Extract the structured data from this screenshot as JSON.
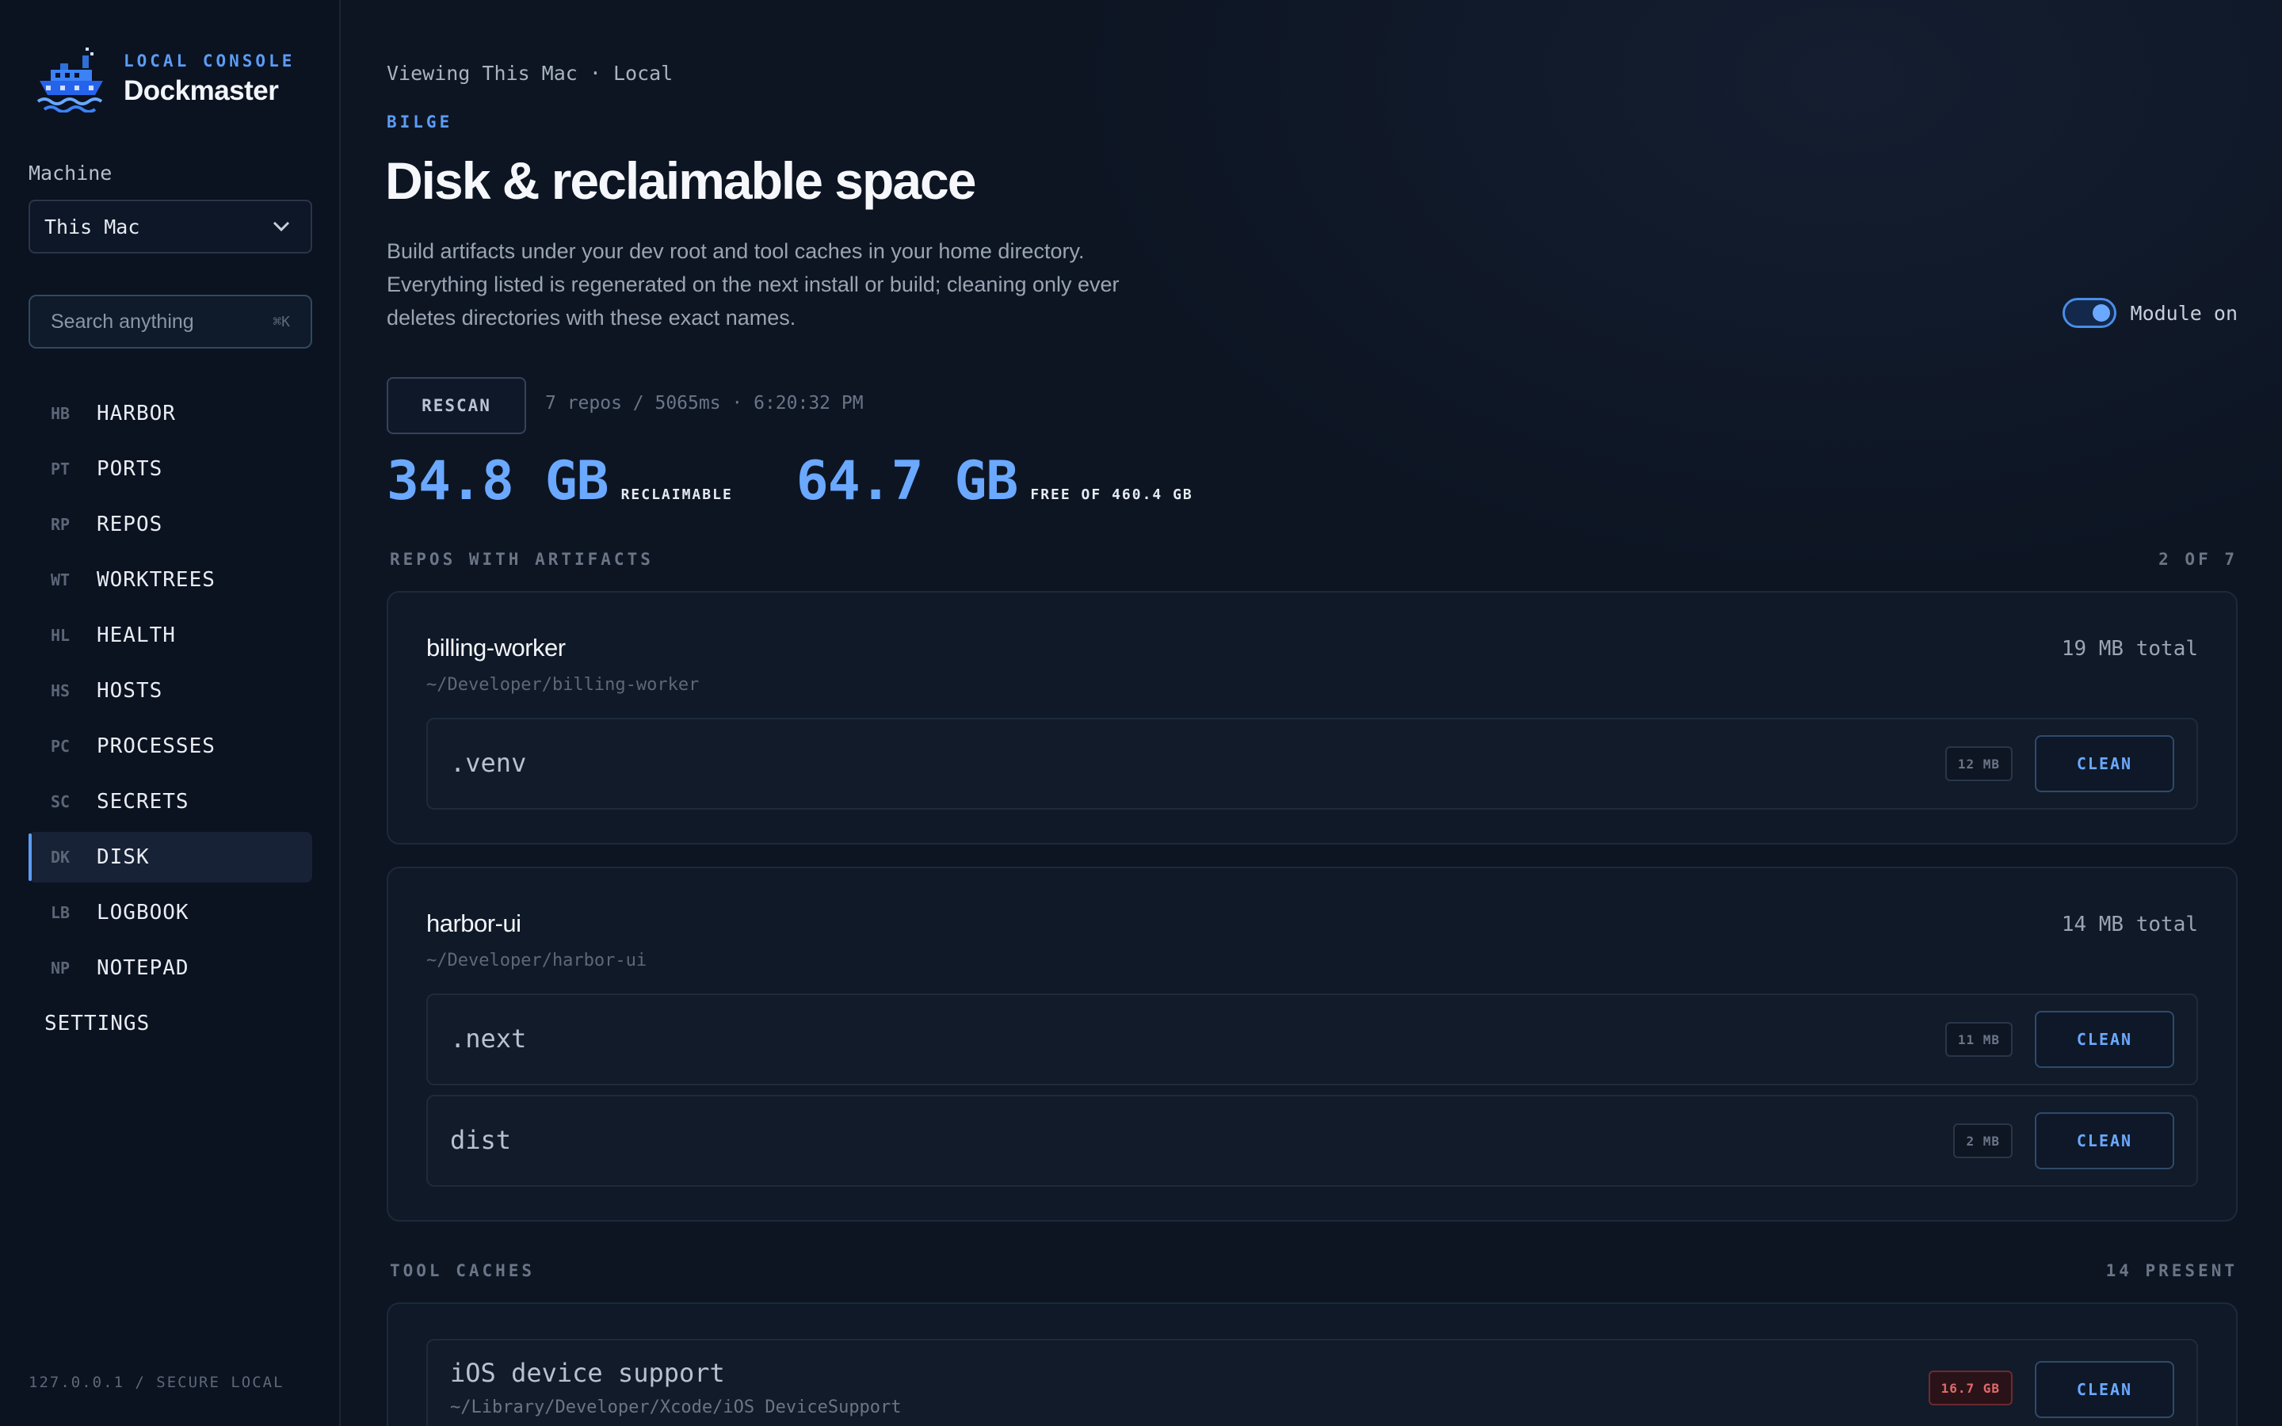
{
  "brand": {
    "eyebrow": "LOCAL CONSOLE",
    "name": "Dockmaster",
    "logo_icon": "ship-icon"
  },
  "machine": {
    "label": "Machine",
    "selected": "This Mac"
  },
  "search": {
    "placeholder": "Search anything",
    "shortcut": "⌘K"
  },
  "nav": {
    "items": [
      {
        "code": "HB",
        "label": "HARBOR"
      },
      {
        "code": "PT",
        "label": "PORTS"
      },
      {
        "code": "RP",
        "label": "REPOS"
      },
      {
        "code": "WT",
        "label": "WORKTREES"
      },
      {
        "code": "HL",
        "label": "HEALTH"
      },
      {
        "code": "HS",
        "label": "HOSTS"
      },
      {
        "code": "PC",
        "label": "PROCESSES"
      },
      {
        "code": "SC",
        "label": "SECRETS"
      },
      {
        "code": "DK",
        "label": "DISK"
      },
      {
        "code": "LB",
        "label": "LOGBOOK"
      },
      {
        "code": "NP",
        "label": "NOTEPAD"
      }
    ],
    "active": "DISK",
    "settings": "SETTINGS"
  },
  "footer": {
    "address": "127.0.0.1 / SECURE LOCAL"
  },
  "header": {
    "breadcrumb": "Viewing This Mac · Local",
    "eyebrow": "BILGE",
    "title": "Disk & reclaimable space",
    "description": "Build artifacts under your dev root and tool caches in your home directory. Everything listed is regenerated on the next install or build; cleaning only ever deletes directories with these exact names."
  },
  "module_toggle": {
    "label": "Module on",
    "on": true
  },
  "scan": {
    "button_label": "RESCAN",
    "meta": "7 repos / 5065ms · 6:20:32 PM"
  },
  "stats": {
    "reclaimable_value": "34.8 GB",
    "reclaimable_label": "RECLAIMABLE",
    "free_value": "64.7 GB",
    "free_label": "FREE OF 460.4 GB"
  },
  "repos_section": {
    "title": "REPOS WITH ARTIFACTS",
    "count": "2 OF 7"
  },
  "repos": [
    {
      "name": "billing-worker",
      "path": "~/Developer/billing-worker",
      "total": "19 MB total",
      "artifacts": [
        {
          "name": ".venv",
          "size": "12 MB",
          "action": "CLEAN"
        }
      ]
    },
    {
      "name": "harbor-ui",
      "path": "~/Developer/harbor-ui",
      "total": "14 MB total",
      "artifacts": [
        {
          "name": ".next",
          "size": "11 MB",
          "action": "CLEAN"
        },
        {
          "name": "dist",
          "size": "2 MB",
          "action": "CLEAN"
        }
      ]
    }
  ],
  "caches_section": {
    "title": "TOOL CACHES",
    "count": "14 PRESENT"
  },
  "caches": [
    {
      "name": "iOS device support",
      "path": "~/Library/Developer/Xcode/iOS DeviceSupport",
      "size": "16.7 GB",
      "action": "CLEAN"
    }
  ],
  "colors": {
    "accent": "#6aa9ff",
    "warn": "#e26a6a",
    "background": "#0d1523"
  }
}
